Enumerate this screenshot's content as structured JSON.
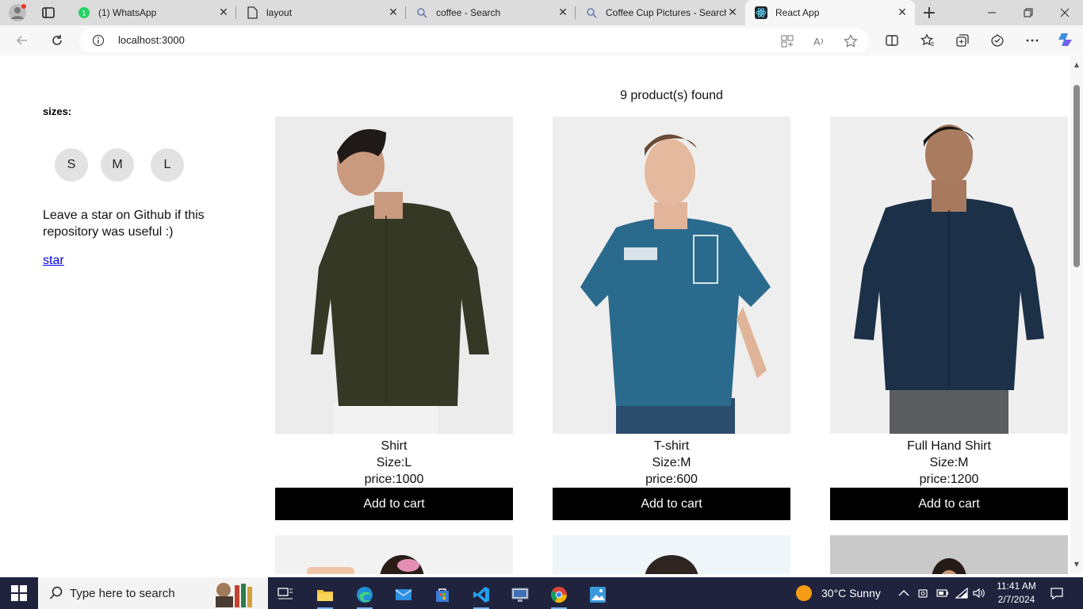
{
  "browser": {
    "tabs": [
      {
        "title": "(1) WhatsApp",
        "icon": "whatsapp-icon"
      },
      {
        "title": "layout",
        "icon": "page-icon"
      },
      {
        "title": "coffee - Search",
        "icon": "search-icon"
      },
      {
        "title": "Coffee Cup Pictures - Search",
        "icon": "search-icon"
      },
      {
        "title": "React App",
        "icon": "react-icon"
      }
    ],
    "url": "localhost:3000"
  },
  "page": {
    "sidebar": {
      "sizes_label": "sizes:",
      "sizes": [
        "S",
        "M",
        "L"
      ],
      "promo_text": "Leave a star on Github if this repository was useful :)",
      "star_link": "star"
    },
    "products_found": "9 product(s) found",
    "products": [
      {
        "name": "Shirt",
        "size": "Size:L",
        "price": "price:1000",
        "button": "Add to cart",
        "shirt_color": "#353825"
      },
      {
        "name": "T-shirt",
        "size": "Size:M",
        "price": "price:600",
        "button": "Add to cart",
        "shirt_color": "#2a6a8c"
      },
      {
        "name": "Full Hand Shirt",
        "size": "Size:M",
        "price": "price:1200",
        "button": "Add to cart",
        "shirt_color": "#1c3048"
      }
    ]
  },
  "taskbar": {
    "search_placeholder": "Type here to search",
    "weather": "30°C  Sunny",
    "time": "11:41 AM",
    "date": "2/7/2024"
  }
}
